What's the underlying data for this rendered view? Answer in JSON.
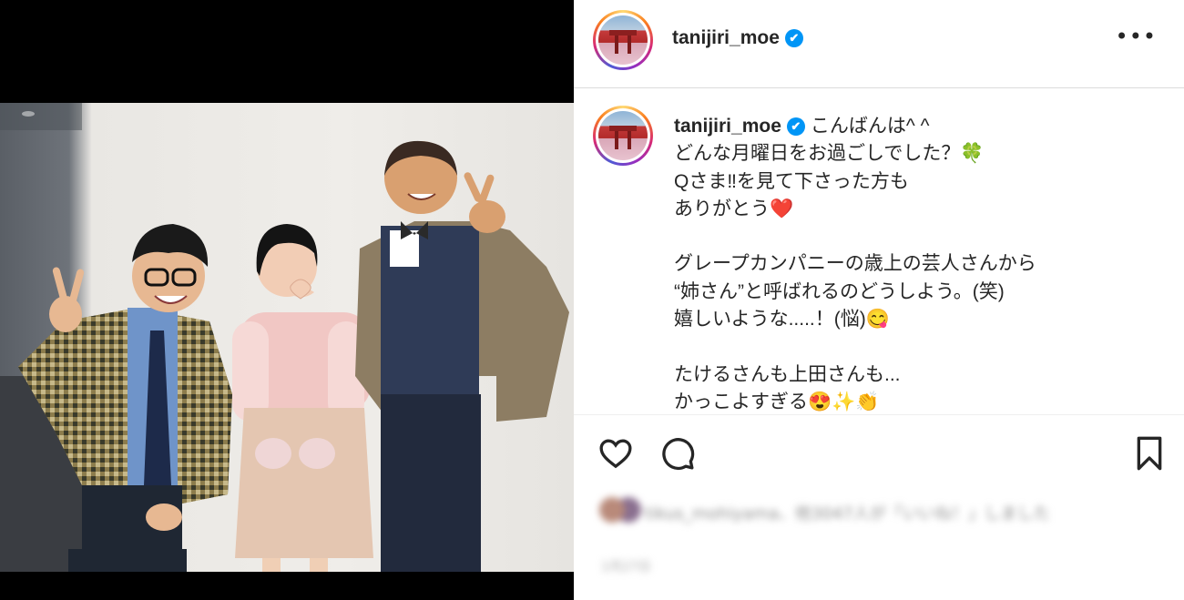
{
  "post": {
    "username": "tanijiri_moe",
    "verified_mark": "✔",
    "more_label": "•••",
    "caption_lines": [
      "こんばんは^ ^",
      "どんな月曜日をお過ごしでした？🍀",
      "Qさま‼を見て下さった方も",
      "ありがとう❤️",
      "",
      "グレープカンパニーの歳上の芸人さんから",
      "“姉さん”と呼ばれるのどうしよう。(笑)",
      "嬉しいような.....！(悩)😋",
      "",
      "たけるさんも上田さんも...",
      "かっこよすぎる😍✨👏"
    ]
  },
  "actions": {
    "like_icon": "heart-icon",
    "comment_icon": "comment-icon",
    "save_icon": "bookmark-icon"
  },
  "blurred": {
    "likes_text": "tikus_mohiyama、他3047人が「いいね！」しました",
    "date_text": "1月27日"
  },
  "colors": {
    "accent_blue": "#0095f6",
    "text": "#262626",
    "divider": "#dbdbdb"
  }
}
